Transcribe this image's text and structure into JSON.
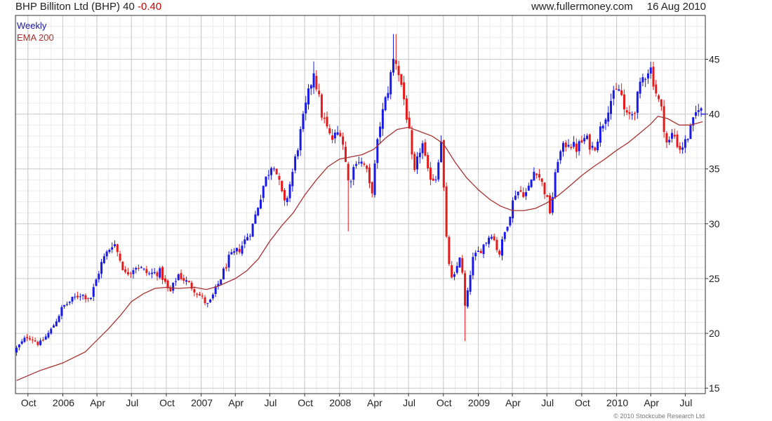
{
  "header": {
    "company": "BHP Billiton Ltd (BHP)",
    "price": "40",
    "change": "-0.40",
    "site": "www.fullermoney.com",
    "date": "16 Aug 2010"
  },
  "legend": {
    "frequency": "Weekly",
    "indicator": "EMA 200"
  },
  "footer": {
    "copyright": "© 2010 Stockcube Research Ltd"
  },
  "colors": {
    "up": "#1a1ae6",
    "down": "#e61a1a",
    "ema": "#a83232",
    "grid": "#dcdcdc",
    "axis": "#333333"
  },
  "chart_data": {
    "type": "candlestick",
    "x_ticks": [
      {
        "label": "Oct",
        "date": "2005-10-01"
      },
      {
        "label": "2006",
        "date": "2006-01-01"
      },
      {
        "label": "Apr",
        "date": "2006-04-01"
      },
      {
        "label": "Jul",
        "date": "2006-07-01"
      },
      {
        "label": "Oct",
        "date": "2006-10-01"
      },
      {
        "label": "2007",
        "date": "2007-01-01"
      },
      {
        "label": "Apr",
        "date": "2007-04-01"
      },
      {
        "label": "Jul",
        "date": "2007-07-01"
      },
      {
        "label": "Oct",
        "date": "2007-10-01"
      },
      {
        "label": "2008",
        "date": "2008-01-01"
      },
      {
        "label": "Apr",
        "date": "2008-04-01"
      },
      {
        "label": "Jul",
        "date": "2008-07-01"
      },
      {
        "label": "Oct",
        "date": "2008-10-01"
      },
      {
        "label": "2009",
        "date": "2009-01-01"
      },
      {
        "label": "Apr",
        "date": "2009-04-01"
      },
      {
        "label": "Jul",
        "date": "2009-07-01"
      },
      {
        "label": "Oct",
        "date": "2009-10-01"
      },
      {
        "label": "2010",
        "date": "2010-01-01"
      },
      {
        "label": "Apr",
        "date": "2010-04-01"
      },
      {
        "label": "Jul",
        "date": "2010-07-01"
      }
    ],
    "y_ticks": [
      15,
      20,
      25,
      30,
      35,
      40,
      45
    ],
    "ylim": [
      14.5,
      49
    ],
    "xlim": [
      "2005-08-29",
      "2010-08-23"
    ],
    "grid": true,
    "price_axis": "right",
    "series": [
      {
        "name": "Weekly",
        "kind": "ohlc",
        "frequency": "weekly",
        "close_path": [
          [
            "2005-09-01",
            18.6
          ],
          [
            "2005-10-01",
            19.8
          ],
          [
            "2005-11-01",
            19.0
          ],
          [
            "2005-12-01",
            20.3
          ],
          [
            "2006-01-01",
            22.4
          ],
          [
            "2006-02-15",
            23.6
          ],
          [
            "2006-03-15",
            23.2
          ],
          [
            "2006-04-15",
            26.6
          ],
          [
            "2006-05-15",
            28.4
          ],
          [
            "2006-06-15",
            25.4
          ],
          [
            "2006-07-15",
            26.2
          ],
          [
            "2006-08-15",
            25.4
          ],
          [
            "2006-09-15",
            25.6
          ],
          [
            "2006-10-10",
            23.6
          ],
          [
            "2006-11-01",
            25.4
          ],
          [
            "2006-12-15",
            24.0
          ],
          [
            "2007-01-20",
            22.5
          ],
          [
            "2007-02-15",
            24.5
          ],
          [
            "2007-03-15",
            26.8
          ],
          [
            "2007-04-15",
            27.8
          ],
          [
            "2007-05-15",
            29.6
          ],
          [
            "2007-06-15",
            33.6
          ],
          [
            "2007-07-10",
            35.8
          ],
          [
            "2007-08-10",
            31.6
          ],
          [
            "2007-09-01",
            35.0
          ],
          [
            "2007-10-01",
            40.2
          ],
          [
            "2007-10-25",
            44.0
          ],
          [
            "2007-11-15",
            40.0
          ],
          [
            "2007-12-10",
            37.6
          ],
          [
            "2008-01-05",
            38.6
          ],
          [
            "2008-01-25",
            33.6
          ],
          [
            "2008-02-15",
            36.0
          ],
          [
            "2008-03-10",
            35.2
          ],
          [
            "2008-03-25",
            32.5
          ],
          [
            "2008-04-15",
            38.8
          ],
          [
            "2008-05-10",
            42.6
          ],
          [
            "2008-05-25",
            45.5
          ],
          [
            "2008-06-15",
            42.2
          ],
          [
            "2008-07-01",
            38.8
          ],
          [
            "2008-07-15",
            34.2
          ],
          [
            "2008-08-05",
            37.6
          ],
          [
            "2008-08-20",
            34.6
          ],
          [
            "2008-09-10",
            34.0
          ],
          [
            "2008-09-25",
            37.8
          ],
          [
            "2008-10-10",
            27.8
          ],
          [
            "2008-10-25",
            24.4
          ],
          [
            "2008-11-15",
            27.4
          ],
          [
            "2008-11-28",
            22.0
          ],
          [
            "2008-12-15",
            26.6
          ],
          [
            "2009-01-10",
            27.8
          ],
          [
            "2009-02-05",
            29.2
          ],
          [
            "2009-02-25",
            27.2
          ],
          [
            "2009-03-15",
            29.6
          ],
          [
            "2009-04-10",
            33.0
          ],
          [
            "2009-05-10",
            32.8
          ],
          [
            "2009-06-01",
            35.2
          ],
          [
            "2009-06-25",
            33.0
          ],
          [
            "2009-07-10",
            31.0
          ],
          [
            "2009-07-30",
            36.0
          ],
          [
            "2009-08-25",
            37.6
          ],
          [
            "2009-09-15",
            36.8
          ],
          [
            "2009-10-10",
            37.8
          ],
          [
            "2009-11-01",
            36.8
          ],
          [
            "2009-11-25",
            39.2
          ],
          [
            "2009-12-15",
            41.2
          ],
          [
            "2010-01-10",
            42.4
          ],
          [
            "2010-01-25",
            39.6
          ],
          [
            "2010-02-15",
            40.2
          ],
          [
            "2010-03-10",
            43.2
          ],
          [
            "2010-03-30",
            44.4
          ],
          [
            "2010-04-15",
            42.0
          ],
          [
            "2010-04-30",
            40.2
          ],
          [
            "2010-05-15",
            37.0
          ],
          [
            "2010-05-30",
            38.4
          ],
          [
            "2010-06-15",
            36.8
          ],
          [
            "2010-07-01",
            37.4
          ],
          [
            "2010-07-20",
            39.0
          ],
          [
            "2010-08-05",
            40.8
          ],
          [
            "2010-08-16",
            40.0
          ]
        ],
        "extremes": [
          {
            "date": "2008-05-25",
            "high": 47.3
          },
          {
            "date": "2008-11-28",
            "low": 19.3
          },
          {
            "date": "2008-01-25",
            "low": 29.3
          },
          {
            "date": "2007-10-25",
            "high": 44.8
          }
        ]
      },
      {
        "name": "EMA 200",
        "kind": "line",
        "points": [
          [
            "2005-09-01",
            15.7
          ],
          [
            "2005-11-01",
            16.6
          ],
          [
            "2006-01-01",
            17.3
          ],
          [
            "2006-03-01",
            18.3
          ],
          [
            "2006-05-01",
            20.4
          ],
          [
            "2006-06-01",
            21.6
          ],
          [
            "2006-07-01",
            22.9
          ],
          [
            "2006-08-01",
            23.6
          ],
          [
            "2006-09-01",
            24.1
          ],
          [
            "2006-10-01",
            24.2
          ],
          [
            "2006-11-01",
            24.1
          ],
          [
            "2006-12-15",
            24.2
          ],
          [
            "2007-01-15",
            24.0
          ],
          [
            "2007-02-15",
            24.3
          ],
          [
            "2007-04-01",
            25.0
          ],
          [
            "2007-05-01",
            25.7
          ],
          [
            "2007-06-01",
            26.8
          ],
          [
            "2007-07-01",
            28.4
          ],
          [
            "2007-08-01",
            29.8
          ],
          [
            "2007-09-01",
            31.0
          ],
          [
            "2007-10-01",
            32.6
          ],
          [
            "2007-11-01",
            34.0
          ],
          [
            "2007-12-01",
            35.2
          ],
          [
            "2008-01-01",
            35.9
          ],
          [
            "2008-02-01",
            36.1
          ],
          [
            "2008-03-01",
            36.3
          ],
          [
            "2008-04-01",
            36.8
          ],
          [
            "2008-05-01",
            37.8
          ],
          [
            "2008-06-01",
            38.6
          ],
          [
            "2008-07-01",
            38.8
          ],
          [
            "2008-08-01",
            38.4
          ],
          [
            "2008-09-01",
            38.0
          ],
          [
            "2008-10-01",
            37.3
          ],
          [
            "2008-11-01",
            35.6
          ],
          [
            "2008-12-01",
            34.2
          ],
          [
            "2009-01-01",
            33.1
          ],
          [
            "2009-02-01",
            32.2
          ],
          [
            "2009-03-01",
            31.6
          ],
          [
            "2009-04-01",
            31.2
          ],
          [
            "2009-05-01",
            31.2
          ],
          [
            "2009-06-01",
            31.4
          ],
          [
            "2009-07-01",
            31.9
          ],
          [
            "2009-08-01",
            32.6
          ],
          [
            "2009-09-01",
            33.5
          ],
          [
            "2009-10-01",
            34.4
          ],
          [
            "2009-11-01",
            35.2
          ],
          [
            "2009-12-01",
            35.9
          ],
          [
            "2010-01-01",
            36.7
          ],
          [
            "2010-02-01",
            37.4
          ],
          [
            "2010-03-01",
            38.2
          ],
          [
            "2010-04-01",
            39.1
          ],
          [
            "2010-04-20",
            39.8
          ],
          [
            "2010-05-15",
            39.6
          ],
          [
            "2010-06-15",
            39.0
          ],
          [
            "2010-07-15",
            39.0
          ],
          [
            "2010-08-16",
            39.3
          ]
        ]
      }
    ]
  }
}
